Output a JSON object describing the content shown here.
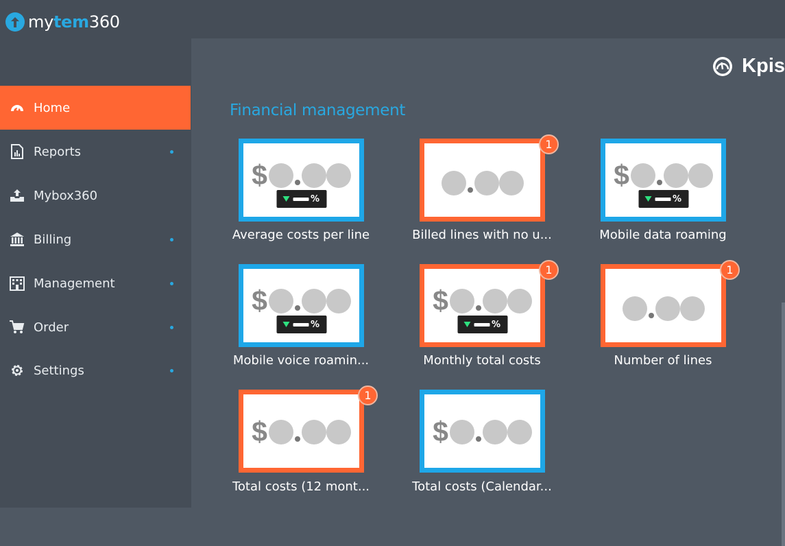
{
  "app": {
    "logo_prefix": "my",
    "logo_strong": "tem",
    "logo_suffix": "360"
  },
  "nav": [
    {
      "label": "Home",
      "icon": "gauge-icon",
      "active": true,
      "dot": false
    },
    {
      "label": "Reports",
      "icon": "report-icon",
      "active": false,
      "dot": true
    },
    {
      "label": "Mybox360",
      "icon": "tray-upload-icon",
      "active": false,
      "dot": false
    },
    {
      "label": "Billing",
      "icon": "bank-icon",
      "active": false,
      "dot": true
    },
    {
      "label": "Management",
      "icon": "building-icon",
      "active": false,
      "dot": true
    },
    {
      "label": "Order",
      "icon": "cart-icon",
      "active": false,
      "dot": true
    },
    {
      "label": "Settings",
      "icon": "gear-icon",
      "active": false,
      "dot": true
    }
  ],
  "header": {
    "title": "Kpis",
    "icon": "speedometer-icon"
  },
  "section": {
    "title": "Financial management"
  },
  "tiles": [
    {
      "label": "Average costs per line",
      "dollar": "$",
      "value_a": "0",
      "value_b": "00",
      "color": "blue",
      "badge": "",
      "pct": true
    },
    {
      "label": "Billed lines with no u...",
      "dollar": "",
      "value_a": "0",
      "value_b": "00",
      "color": "orange",
      "badge": "1",
      "pct": false
    },
    {
      "label": "Mobile data roaming",
      "dollar": "$",
      "value_a": "0",
      "value_b": "00",
      "color": "blue",
      "badge": "",
      "pct": true
    },
    {
      "label": "Mobile voice roamin...",
      "dollar": "$",
      "value_a": "0",
      "value_b": "00",
      "color": "blue",
      "badge": "",
      "pct": true
    },
    {
      "label": "Monthly total costs",
      "dollar": "$",
      "value_a": "0",
      "value_b": "00",
      "color": "orange",
      "badge": "1",
      "pct": true
    },
    {
      "label": "Number of lines",
      "dollar": "",
      "value_a": "0",
      "value_b": "00",
      "color": "orange",
      "badge": "1",
      "pct": false
    },
    {
      "label": "Total costs (12 mont...",
      "dollar": "$",
      "value_a": "0",
      "value_b": "00",
      "color": "orange",
      "badge": "1",
      "pct": false
    },
    {
      "label": "Total costs (Calendar...",
      "dollar": "$",
      "value_a": "0",
      "value_b": "00",
      "color": "blue",
      "badge": "",
      "pct": false
    }
  ],
  "pct_symbol": "%",
  "colors": {
    "accent_orange": "#ff6633",
    "accent_blue": "#1ea7e8",
    "sidebar": "#454d57",
    "main": "#4f5863"
  }
}
